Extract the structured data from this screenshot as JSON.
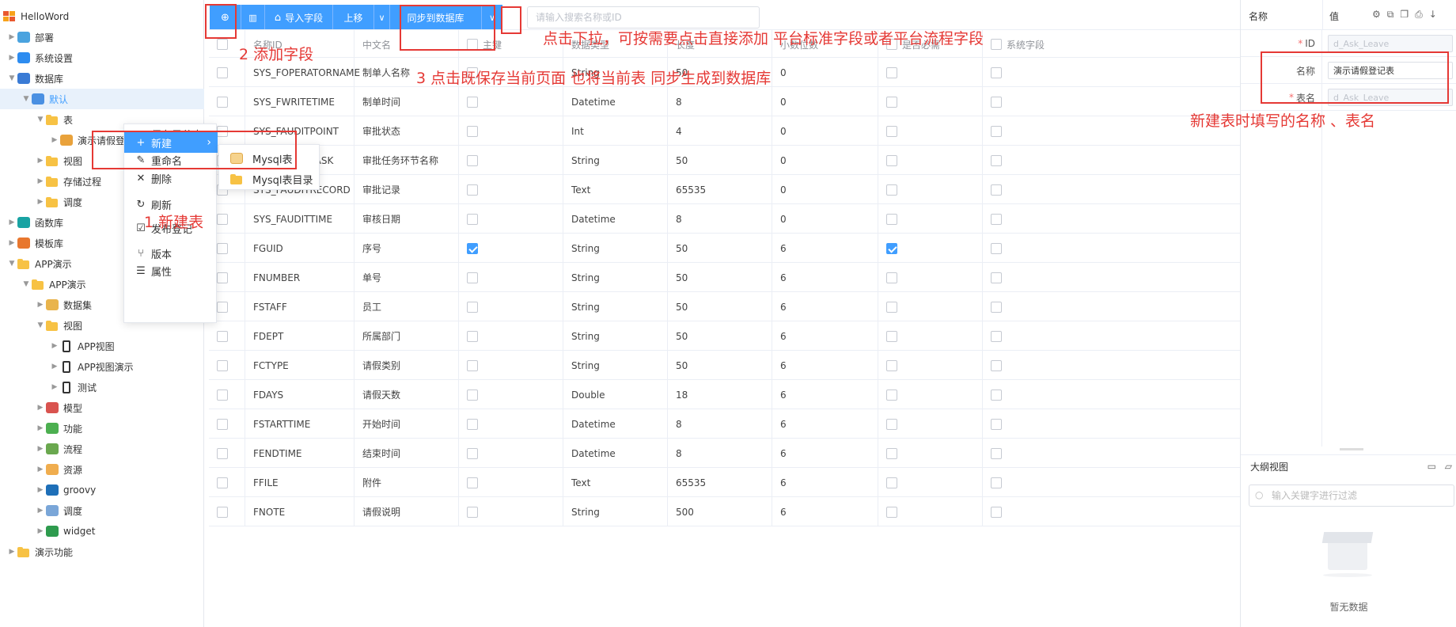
{
  "app": {
    "title": "HelloWord"
  },
  "sidebar": {
    "items": [
      {
        "label": "部署",
        "caret": "▶"
      },
      {
        "label": "系统设置",
        "caret": "▶"
      },
      {
        "label": "数据库",
        "caret": "▼"
      },
      {
        "label": "默认",
        "caret": "▼"
      },
      {
        "label": "表",
        "caret": "▼"
      },
      {
        "label": "演示请假登",
        "caret": "▶"
      },
      {
        "label": "视图",
        "caret": "▶"
      },
      {
        "label": "存储过程",
        "caret": "▶"
      },
      {
        "label": "调度",
        "caret": "▶"
      },
      {
        "label": "函数库",
        "caret": "▶"
      },
      {
        "label": "模板库",
        "caret": "▶"
      },
      {
        "label": "APP演示",
        "caret": "▼"
      },
      {
        "label": "APP演示",
        "caret": "▼"
      },
      {
        "label": "数据集",
        "caret": "▶"
      },
      {
        "label": "视图",
        "caret": "▼"
      },
      {
        "label": "APP视图",
        "caret": "▶"
      },
      {
        "label": "APP视图演示",
        "caret": "▶"
      },
      {
        "label": "测试",
        "caret": "▶"
      },
      {
        "label": "模型",
        "caret": "▶"
      },
      {
        "label": "功能",
        "caret": "▶"
      },
      {
        "label": "流程",
        "caret": "▶"
      },
      {
        "label": "资源",
        "caret": "▶"
      },
      {
        "label": "groovy",
        "caret": "▶"
      },
      {
        "label": "调度",
        "caret": "▶"
      },
      {
        "label": "widget",
        "caret": "▶"
      },
      {
        "label": "演示功能",
        "caret": "▶"
      }
    ]
  },
  "toolbar": {
    "add_icon": "⊕",
    "delete_icon": "🗑",
    "import_label": "导入字段",
    "move_up_label": "上移",
    "dropdown_icon": "⌄",
    "sync_label": "同步到数据库",
    "search_placeholder": "请输入搜索名称或ID"
  },
  "table": {
    "headers": [
      "名称ID",
      "中文名",
      "主键",
      "数据类型",
      "长度",
      "小数位数",
      "是否必需",
      "系统字段"
    ],
    "rows": [
      {
        "id": "SYS_FOPERATORNAME",
        "name": "制单人名称",
        "pk": false,
        "type": "String",
        "len": "50",
        "dec": "0",
        "req": false
      },
      {
        "id": "SYS_FWRITETIME",
        "name": "制单时间",
        "pk": false,
        "type": "Datetime",
        "len": "8",
        "dec": "0",
        "req": false
      },
      {
        "id": "SYS_FAUDITPOINT",
        "name": "审批状态",
        "pk": false,
        "type": "Int",
        "len": "4",
        "dec": "0",
        "req": false
      },
      {
        "id": "SYS_FAUDITTASK",
        "name": "审批任务环节名称",
        "pk": false,
        "type": "String",
        "len": "50",
        "dec": "0",
        "req": false
      },
      {
        "id": "SYS_FAUDITRECORD",
        "name": "审批记录",
        "pk": false,
        "type": "Text",
        "len": "65535",
        "dec": "0",
        "req": false
      },
      {
        "id": "SYS_FAUDITTIME",
        "name": "审核日期",
        "pk": false,
        "type": "Datetime",
        "len": "8",
        "dec": "0",
        "req": false
      },
      {
        "id": "FGUID",
        "name": "序号",
        "pk": true,
        "type": "String",
        "len": "50",
        "dec": "6",
        "req": true
      },
      {
        "id": "FNUMBER",
        "name": "单号",
        "pk": false,
        "type": "String",
        "len": "50",
        "dec": "6",
        "req": false
      },
      {
        "id": "FSTAFF",
        "name": "员工",
        "pk": false,
        "type": "String",
        "len": "50",
        "dec": "6",
        "req": false
      },
      {
        "id": "FDEPT",
        "name": "所属部门",
        "pk": false,
        "type": "String",
        "len": "50",
        "dec": "6",
        "req": false
      },
      {
        "id": "FCTYPE",
        "name": "请假类别",
        "pk": false,
        "type": "String",
        "len": "50",
        "dec": "6",
        "req": false
      },
      {
        "id": "FDAYS",
        "name": "请假天数",
        "pk": false,
        "type": "Double",
        "len": "18",
        "dec": "6",
        "req": false
      },
      {
        "id": "FSTARTTIME",
        "name": "开始时间",
        "pk": false,
        "type": "Datetime",
        "len": "8",
        "dec": "6",
        "req": false
      },
      {
        "id": "FENDTIME",
        "name": "结束时间",
        "pk": false,
        "type": "Datetime",
        "len": "8",
        "dec": "6",
        "req": false
      },
      {
        "id": "FFILE",
        "name": "附件",
        "pk": false,
        "type": "Text",
        "len": "65535",
        "dec": "6",
        "req": false
      },
      {
        "id": "FNOTE",
        "name": "请假说明",
        "pk": false,
        "type": "String",
        "len": "500",
        "dec": "6",
        "req": false
      }
    ]
  },
  "context_menu": {
    "items": [
      {
        "label": "保存子节点",
        "icon": "⧉"
      },
      {
        "label": "新建",
        "icon": "+"
      },
      {
        "label": "重命名",
        "icon": "✎"
      },
      {
        "label": "删除",
        "icon": "✕"
      },
      {
        "label": "刷新",
        "icon": "↻"
      },
      {
        "label": "发布登记",
        "icon": "☑"
      },
      {
        "label": "版本",
        "icon": "⑂"
      },
      {
        "label": "属性",
        "icon": "☰"
      }
    ],
    "submenu_arrow": "›",
    "submenu": [
      {
        "label": "Mysql表"
      },
      {
        "label": "Mysql表目录"
      }
    ]
  },
  "properties": {
    "col_name": "名称",
    "col_value": "值",
    "rows": [
      {
        "label": "ID",
        "required": true,
        "value": "d_Ask_Leave",
        "disabled": true
      },
      {
        "label": "名称",
        "required": false,
        "value": "演示请假登记表",
        "disabled": false
      },
      {
        "label": "表名",
        "required": true,
        "value": "d_Ask_Leave",
        "disabled": true
      }
    ],
    "required_mark": "*"
  },
  "outline": {
    "title": "大纲视图",
    "search_placeholder": "输入关键字进行过滤",
    "empty_text": "暂无数据"
  },
  "annotations": {
    "a1": "1 新建表",
    "a2": "2 添加字段",
    "a3": "点击下拉，可按需要点击直接添加  平台标准字段或者平台流程字段",
    "a4": "3 点击既保存当前页面 也将当前表 同步生成到数据库",
    "a5": "新建表时填写的名称 、表名"
  },
  "colors": {
    "accent": "#409eff",
    "annotation": "#e53935",
    "folder": "#f7c244"
  }
}
